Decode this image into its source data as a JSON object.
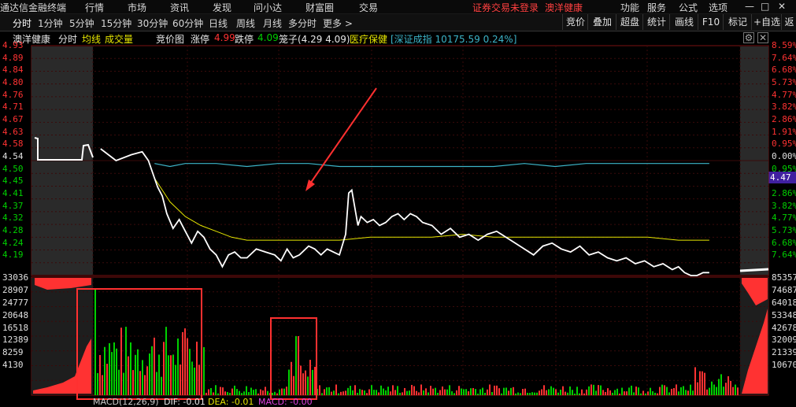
{
  "menubar": {
    "app_title": "通达信金融终端",
    "items": [
      "行情",
      "市场",
      "资讯",
      "发现",
      "问小达",
      "财富圈",
      "交易"
    ],
    "login_status": "证券交易未登录",
    "stock_name": "澳洋健康",
    "right_items": [
      "功能",
      "服务",
      "公式",
      "选项"
    ]
  },
  "period_tabs": [
    "分时",
    "1分钟",
    "5分钟",
    "15分钟",
    "30分钟",
    "60分钟",
    "日线",
    "周线",
    "月线",
    "多分时",
    "更多 >"
  ],
  "active_tab": "分时",
  "right_tabs": [
    "竞价",
    "叠加",
    "超盘",
    "统计",
    "画线",
    "F10",
    "标记",
    "+自选",
    "返"
  ],
  "info": {
    "name": "澳洋健康",
    "mode": "分时",
    "avg_line": "均线",
    "volume": "成交量",
    "auction": "竞价图",
    "limit_up_label": "涨停",
    "limit_up": "4.99",
    "limit_down_label": "跌停",
    "limit_down": "4.09",
    "range_label": "笼子(4.29 4.09)",
    "sector": "医疗保健",
    "index": "[深证成指 10175.59 0.24%]"
  },
  "price_axis": {
    "left": [
      "4.93",
      "4.89",
      "4.84",
      "4.80",
      "4.76",
      "4.71",
      "4.67",
      "4.63",
      "4.58",
      "4.54",
      "4.50",
      "4.45",
      "4.41",
      "4.37",
      "4.32",
      "4.28",
      "4.24",
      "4.19"
    ],
    "right": [
      "8.59%",
      "7.64%",
      "6.68%",
      "5.73%",
      "4.77%",
      "3.82%",
      "2.86%",
      "1.91%",
      "0.95%",
      "0.00%",
      "0.95%",
      "1.91%",
      "2.86%",
      "3.82%",
      "4.77%",
      "5.73%",
      "6.68%",
      "7.64%"
    ],
    "current_price": "4.47"
  },
  "volume_axis": {
    "left": [
      "33036",
      "28907",
      "24777",
      "20648",
      "16518",
      "12389",
      "8259",
      "4130"
    ],
    "right": [
      "85357",
      "74687",
      "64018",
      "53348",
      "42678",
      "32009",
      "21339",
      "10670"
    ]
  },
  "macd": {
    "label": "MACD(12,26,9)",
    "dif": "DIF: -0.01",
    "dea": "DEA: -0.01",
    "macd": "MACD: -0.00"
  },
  "colors": {
    "up": "#ff3232",
    "down": "#00d000",
    "price_line": "#ffffff",
    "avg_line": "#e6e600",
    "index_line": "#3cb4c8",
    "annotation": "#ff3030"
  },
  "chart_data": {
    "type": "line",
    "price_series": [
      [
        0.05,
        4.6
      ],
      [
        0.15,
        4.56
      ],
      [
        0.25,
        4.58
      ],
      [
        0.32,
        4.59
      ],
      [
        0.36,
        4.56
      ],
      [
        0.4,
        4.5
      ],
      [
        0.42,
        4.47
      ],
      [
        0.45,
        4.44
      ],
      [
        0.48,
        4.38
      ],
      [
        0.52,
        4.33
      ],
      [
        0.56,
        4.36
      ],
      [
        0.6,
        4.32
      ],
      [
        0.64,
        4.28
      ],
      [
        0.68,
        4.32
      ],
      [
        0.72,
        4.3
      ],
      [
        0.76,
        4.26
      ],
      [
        0.8,
        4.24
      ],
      [
        0.84,
        4.2
      ],
      [
        0.88,
        4.24
      ],
      [
        0.92,
        4.25
      ],
      [
        0.96,
        4.23
      ],
      [
        1.0,
        4.23
      ],
      [
        1.06,
        4.26
      ],
      [
        1.12,
        4.25
      ],
      [
        1.18,
        4.24
      ],
      [
        1.22,
        4.22
      ],
      [
        1.26,
        4.26
      ],
      [
        1.3,
        4.23
      ],
      [
        1.34,
        4.24
      ],
      [
        1.4,
        4.27
      ],
      [
        1.44,
        4.26
      ],
      [
        1.48,
        4.24
      ],
      [
        1.52,
        4.26
      ],
      [
        1.56,
        4.25
      ],
      [
        1.6,
        4.24
      ],
      [
        1.64,
        4.31
      ],
      [
        1.66,
        4.45
      ],
      [
        1.68,
        4.46
      ],
      [
        1.7,
        4.4
      ],
      [
        1.72,
        4.34
      ],
      [
        1.74,
        4.37
      ],
      [
        1.78,
        4.35
      ],
      [
        1.82,
        4.36
      ],
      [
        1.86,
        4.34
      ],
      [
        1.9,
        4.35
      ],
      [
        1.94,
        4.37
      ],
      [
        1.98,
        4.38
      ],
      [
        2.02,
        4.36
      ],
      [
        2.06,
        4.38
      ],
      [
        2.1,
        4.37
      ],
      [
        2.14,
        4.35
      ],
      [
        2.2,
        4.34
      ],
      [
        2.26,
        4.31
      ],
      [
        2.32,
        4.33
      ],
      [
        2.38,
        4.3
      ],
      [
        2.44,
        4.31
      ],
      [
        2.5,
        4.29
      ],
      [
        2.56,
        4.31
      ],
      [
        2.62,
        4.32
      ],
      [
        2.68,
        4.3
      ],
      [
        2.74,
        4.28
      ],
      [
        2.8,
        4.26
      ],
      [
        2.86,
        4.24
      ],
      [
        2.92,
        4.27
      ],
      [
        2.98,
        4.28
      ],
      [
        3.04,
        4.26
      ],
      [
        3.1,
        4.25
      ],
      [
        3.16,
        4.27
      ],
      [
        3.22,
        4.24
      ],
      [
        3.28,
        4.25
      ],
      [
        3.34,
        4.23
      ],
      [
        3.4,
        4.22
      ],
      [
        3.46,
        4.23
      ],
      [
        3.52,
        4.21
      ],
      [
        3.58,
        4.22
      ],
      [
        3.64,
        4.2
      ],
      [
        3.7,
        4.21
      ],
      [
        3.76,
        4.19
      ],
      [
        3.8,
        4.2
      ],
      [
        3.84,
        4.18
      ],
      [
        3.88,
        4.17
      ],
      [
        3.92,
        4.17
      ],
      [
        3.96,
        4.18
      ],
      [
        4.0,
        4.18
      ]
    ],
    "avg_series": [
      [
        0.4,
        4.5
      ],
      [
        0.45,
        4.46
      ],
      [
        0.5,
        4.42
      ],
      [
        0.6,
        4.37
      ],
      [
        0.7,
        4.34
      ],
      [
        0.8,
        4.32
      ],
      [
        0.9,
        4.3
      ],
      [
        1.0,
        4.29
      ],
      [
        1.2,
        4.29
      ],
      [
        1.4,
        4.29
      ],
      [
        1.6,
        4.29
      ],
      [
        1.8,
        4.3
      ],
      [
        2.0,
        4.3
      ],
      [
        2.2,
        4.3
      ],
      [
        2.4,
        4.31
      ],
      [
        2.6,
        4.3
      ],
      [
        2.8,
        4.3
      ],
      [
        3.0,
        4.3
      ],
      [
        3.2,
        4.3
      ],
      [
        3.4,
        4.3
      ],
      [
        3.6,
        4.3
      ],
      [
        3.8,
        4.29
      ],
      [
        4.0,
        4.29
      ]
    ],
    "index_series": [
      [
        0.4,
        4.55
      ],
      [
        0.5,
        4.54
      ],
      [
        0.6,
        4.55
      ],
      [
        0.8,
        4.55
      ],
      [
        1.0,
        4.54
      ],
      [
        1.2,
        4.55
      ],
      [
        1.4,
        4.55
      ],
      [
        1.6,
        4.54
      ],
      [
        1.8,
        4.54
      ],
      [
        2.0,
        4.54
      ],
      [
        2.2,
        4.54
      ],
      [
        2.4,
        4.54
      ],
      [
        2.6,
        4.54
      ],
      [
        2.8,
        4.55
      ],
      [
        3.0,
        4.54
      ],
      [
        3.2,
        4.55
      ],
      [
        3.4,
        4.55
      ],
      [
        3.6,
        4.55
      ],
      [
        3.8,
        4.55
      ],
      [
        4.0,
        4.55
      ]
    ],
    "ylim": [
      4.17,
      4.95
    ],
    "xlim": [
      0,
      4.2
    ],
    "volume_ylim": [
      0,
      33036
    ]
  }
}
